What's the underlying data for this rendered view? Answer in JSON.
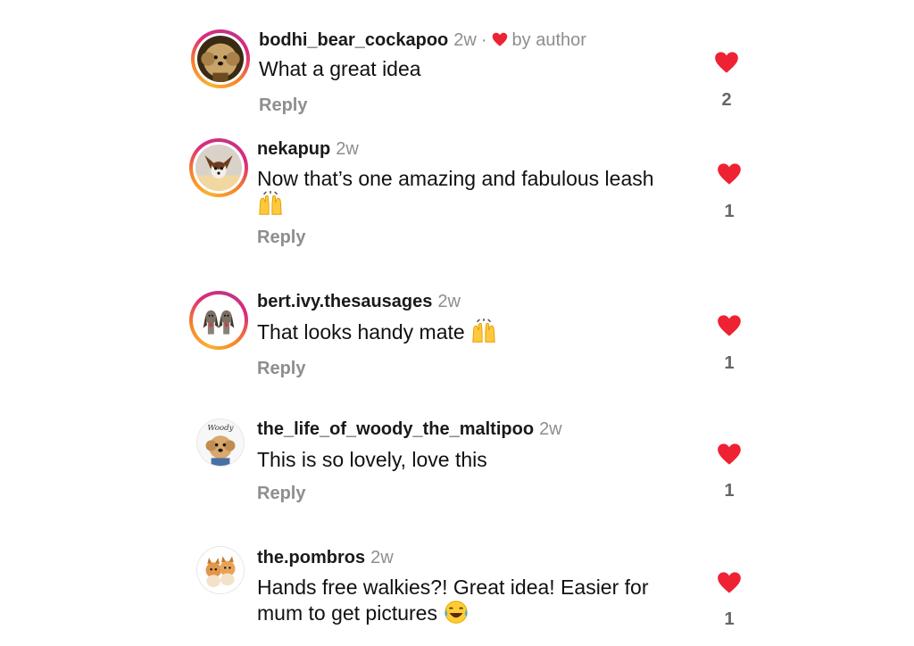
{
  "colors": {
    "heart": "#ee2233",
    "meta_gray": "#8e8e8e",
    "story_ring_start": "#f9b233",
    "story_ring_end": "#c13584"
  },
  "comments": [
    {
      "username": "bodhi_bear_cockapoo",
      "time": "2w",
      "separator": "·",
      "author_like": "by author",
      "text": "What a great idea",
      "reply": "Reply",
      "likes": "2",
      "avatar_icon": "cockapoo-avatar-icon"
    },
    {
      "username": "nekapup",
      "time": "2w",
      "text": "Now that’s one amazing and fabulous leash",
      "emoji": "raising-hands-emoji",
      "reply": "Reply",
      "likes": "1",
      "avatar_icon": "papillon-avatar-icon"
    },
    {
      "username": "bert.ivy.thesausages",
      "time": "2w",
      "text": "That looks handy mate",
      "emoji": "raising-hands-emoji",
      "reply": "Reply",
      "likes": "1",
      "avatar_icon": "sausage-dogs-avatar-icon"
    },
    {
      "username": "the_life_of_woody_the_maltipoo",
      "time": "2w",
      "avatar_label": "Woody",
      "text": "This is so lovely, love this",
      "reply": "Reply",
      "likes": "1",
      "avatar_icon": "maltipoo-avatar-icon"
    },
    {
      "username": "the.pombros",
      "time": "2w",
      "text_line1": "Hands free walkies?! Great idea! Easier for",
      "text_line2": "mum to get pictures",
      "emoji": "laughing-tears-emoji",
      "reply": "Reply",
      "likes": "1",
      "avatar_icon": "pomeranians-avatar-icon"
    }
  ]
}
